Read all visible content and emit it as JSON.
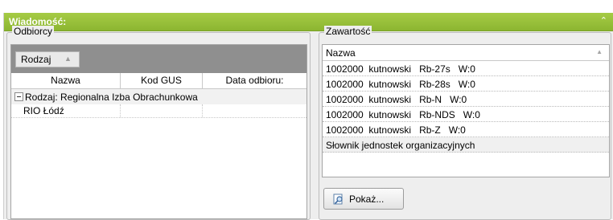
{
  "header": {
    "title": "Wiadomość:",
    "collapse_icon": "double-chevron-up-icon"
  },
  "recipients": {
    "legend": "Odbiorcy",
    "group_chip": "Rodzaj",
    "columns": [
      "Nazwa",
      "Kod GUS",
      "Data odbioru:"
    ],
    "group_row": "Rodzaj: Regionalna Izba Obrachunkowa",
    "rows": [
      {
        "name": "RIO Łódź",
        "kod": "",
        "data": ""
      }
    ]
  },
  "content": {
    "legend": "Zawartość",
    "column": "Nazwa",
    "rows": [
      "1002000  kutnowski   Rb-27s   W:0",
      "1002000  kutnowski   Rb-28s   W:0",
      "1002000  kutnowski   Rb-N   W:0",
      "1002000  kutnowski   Rb-NDS   W:0",
      "1002000  kutnowski   Rb-Z   W:0",
      "Słownik jednostek organizacyjnych"
    ],
    "button_label": "Pokaż...",
    "button_icon": "preview-magnifier-icon"
  }
}
